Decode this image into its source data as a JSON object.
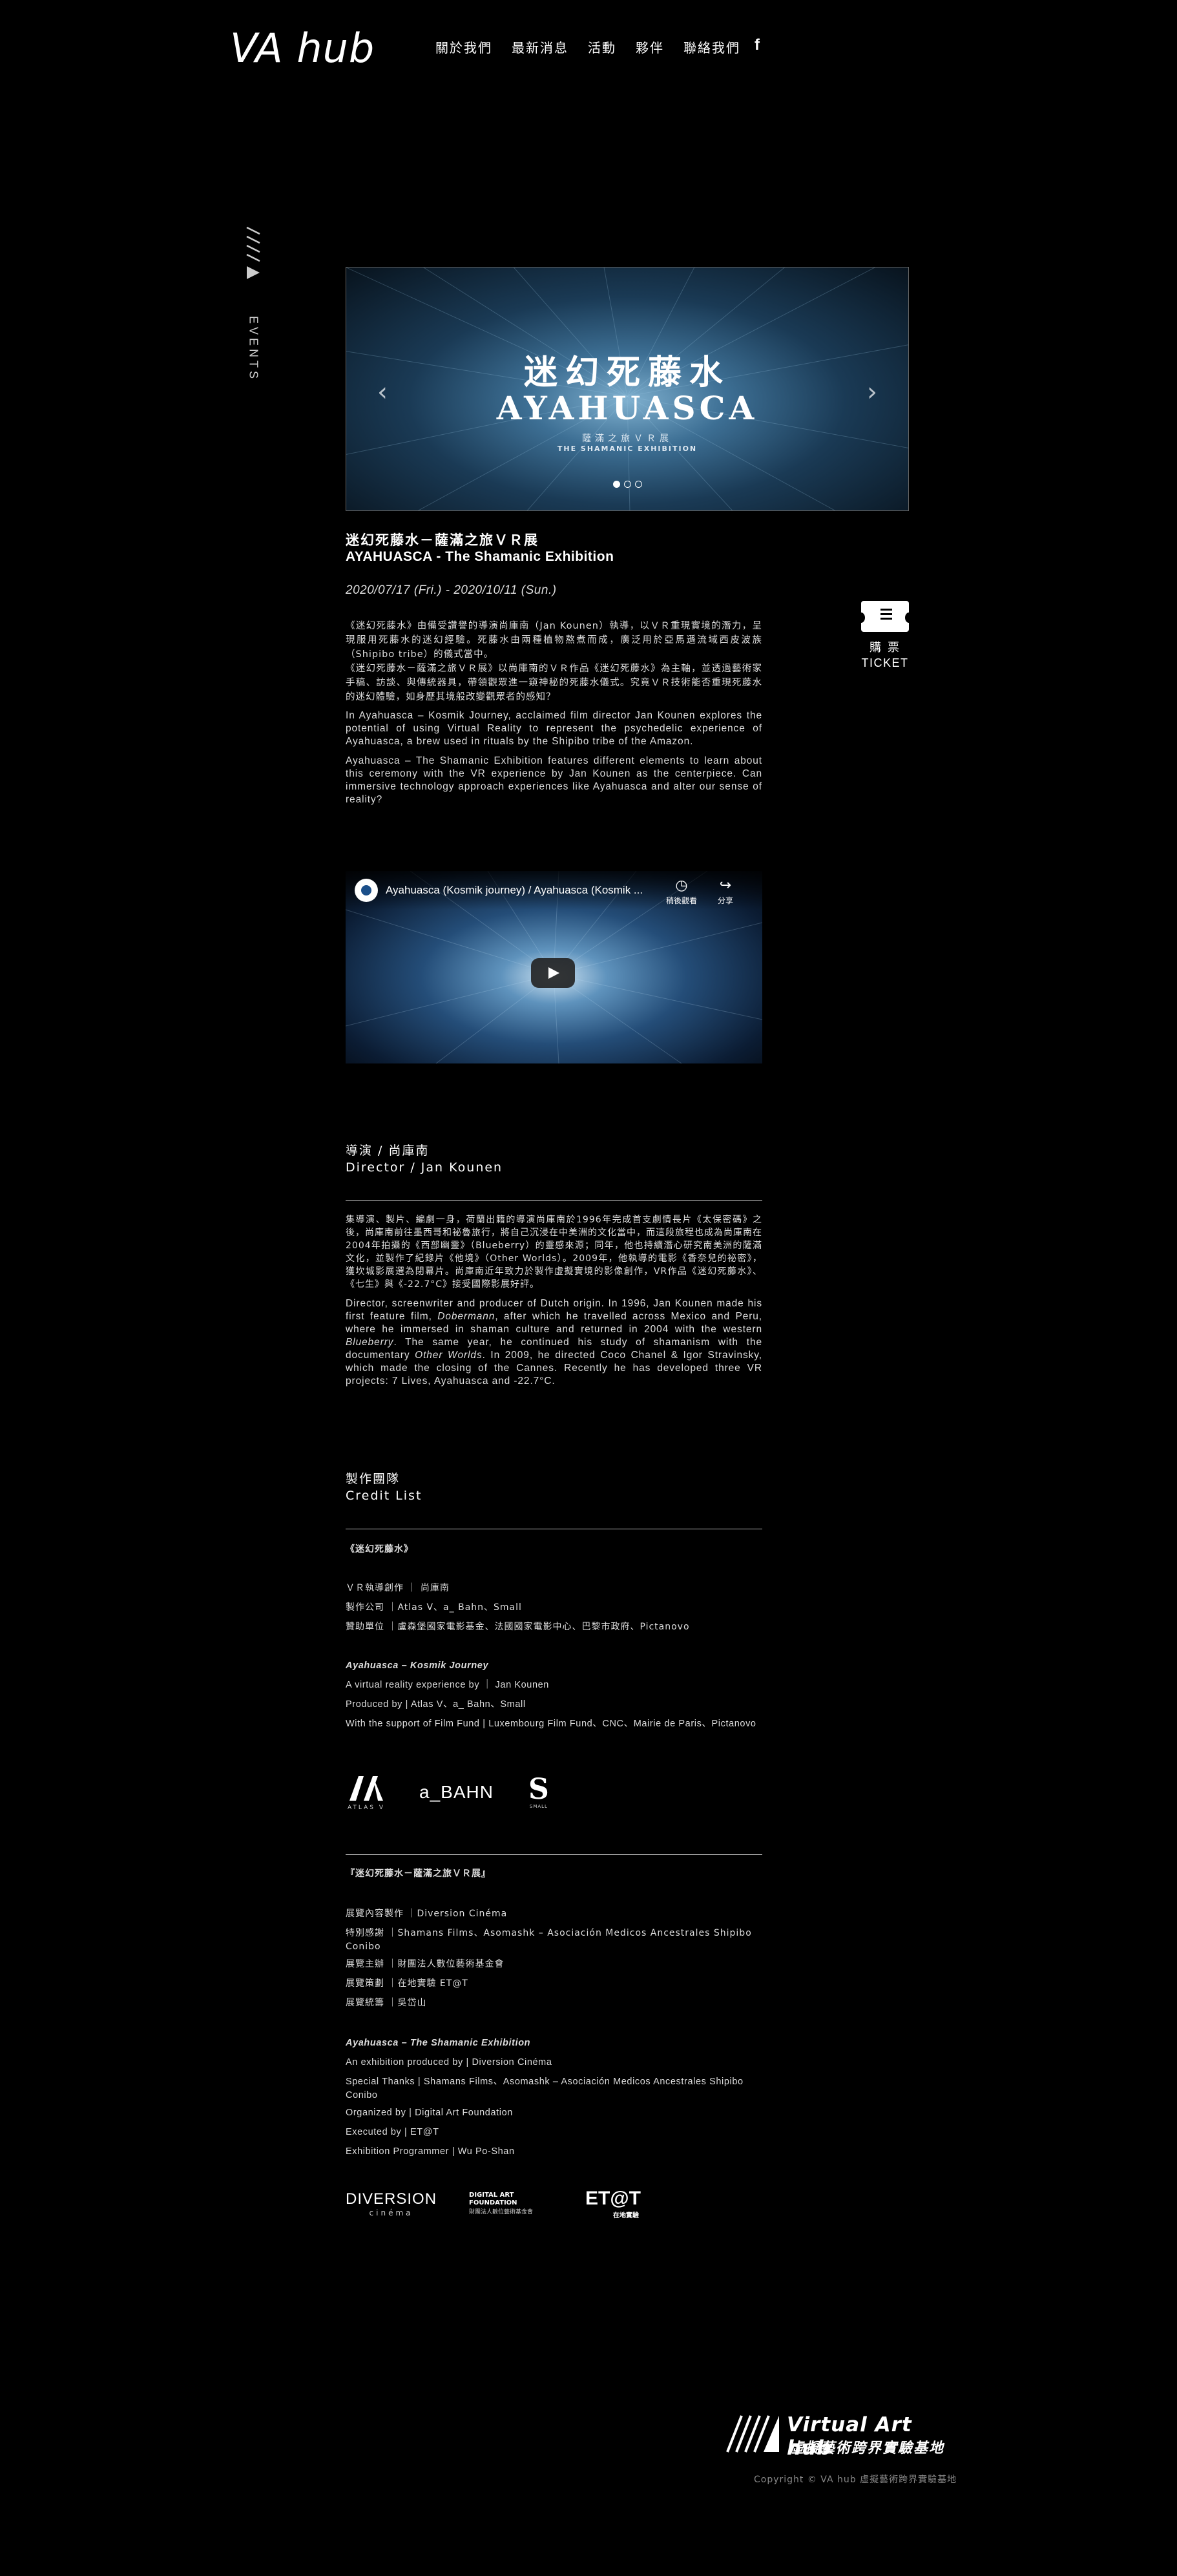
{
  "header": {
    "logo": "VA hub",
    "nav": [
      "關於我們",
      "最新消息",
      "活動",
      "夥伴",
      "聯絡我們"
    ],
    "facebook_icon": "f"
  },
  "side_label": "EVENTS",
  "carousel": {
    "title_cn": "迷幻死藤水",
    "title_en": "AYAHUASCA",
    "subtitle_cn": "薩滿之旅ＶＲ展",
    "subtitle_en": "THE SHAMANIC EXHIBITION",
    "slide_count": 3,
    "active_slide": 1
  },
  "event": {
    "title_cn": "迷幻死藤水－薩滿之旅ＶＲ展",
    "title_en": "AYAHUASCA - The Shamanic Exhibition",
    "date": "2020/07/17 (Fri.) - 2020/10/11 (Sun.)",
    "desc_cn_1": "《迷幻死藤水》由備受讚譽的導演尚庫南（Jan Kounen）執導，以ＶＲ重現實境的潛力，呈現服用死藤水的迷幻經驗。死藤水由兩種植物熬煮而成，廣泛用於亞馬遜流域西皮波族（Shipibo tribe）的儀式當中。",
    "desc_cn_2": "《迷幻死藤水－薩滿之旅ＶＲ展》以尚庫南的ＶＲ作品《迷幻死藤水》為主軸，並透過藝術家手稿、訪談、與傳統器具，帶領觀眾進一窺神秘的死藤水儀式。究竟ＶＲ技術能否重現死藤水的迷幻體驗，如身歷其境般改變觀眾者的感知？",
    "desc_en_1": "In Ayahuasca – Kosmik Journey, acclaimed film director Jan Kounen explores the potential of using Virtual Reality to represent the psychedelic experience of Ayahuasca, a brew used in rituals by the Shipibo tribe of the Amazon.",
    "desc_en_2": "Ayahuasca – The Shamanic Exhibition features different elements to learn about this ceremony with the VR experience by Jan Kounen as the centerpiece. Can immersive technology approach experiences like Ayahuasca and alter our sense of reality?"
  },
  "ticket": {
    "label_cn": "購票",
    "label_en": "TICKET"
  },
  "video": {
    "title": "Ayahuasca (Kosmik journey) / Ayahuasca (Kosmik ...",
    "watch_later": "稍後觀看",
    "share": "分享"
  },
  "director": {
    "heading_cn": "導演 / 尚庫南",
    "heading_en": "Director / Jan Kounen",
    "bio_cn": "集導演、製片、編劇一身，荷蘭出籍的導演尚庫南於1996年完成首支劇情長片《太保密碼》之後，尚庫南前往墨西哥和祕魯旅行，將自己沉浸在中美洲的文化當中，而這段旅程也成為尚庫南在2004年拍攝的《西部幽靈》（Blueberry）的靈感來源；同年，他也持續潛心研究南美洲的薩滿文化，並製作了紀錄片《他境》（Other Worlds）。2009年，他執導的電影《香奈兒的祕密》，獲坎城影展選為閉幕片。尚庫南近年致力於製作虛擬實境的影像創作，VR作品《迷幻死藤水》、《七生》與《-22.7°C》接受國際影展好評。",
    "bio_en_1": "Director, screenwriter and producer of Dutch origin. In 1996, Jan Kounen made his first feature film, ",
    "bio_en_film1": "Dobermann",
    "bio_en_2": ", after which he travelled across Mexico and Peru, where he immersed in shaman culture and returned in 2004 with the western ",
    "bio_en_film2": "Blueberry",
    "bio_en_3": ". The same year, he continued his study of shamanism with the documentary ",
    "bio_en_film3": "Other Worlds",
    "bio_en_4": ". In 2009, he directed Coco Chanel & Igor Stravinsky, which made the closing of the Cannes. Recently he has developed three VR projects: 7 Lives, Ayahuasca and -22.7°C."
  },
  "credits": {
    "heading_cn": "製作團隊",
    "heading_en": "Credit List",
    "vr_title_cn": "《迷幻死藤水》",
    "vr_lines_cn": [
      "ＶＲ執導創作 ｜ 尚庫南",
      "製作公司 ｜Atlas V、a_ Bahn、Small",
      "贊助單位 ｜盧森堡國家電影基金、法國國家電影中心、巴黎市政府、Pictanovo"
    ],
    "vr_title_en": "Ayahuasca – Kosmik Journey",
    "vr_lines_en": [
      "A virtual reality experience by ｜ Jan Kounen",
      "Produced by | Atlas V、a_ Bahn、Small",
      "With the support of Film Fund | Luxembourg Film Fund、CNC、Mairie de Paris、Pictanovo"
    ],
    "vr_logos": [
      "ATLAS V",
      "a_BAHN",
      "SMALL"
    ],
    "exh_title_cn": "『迷幻死藤水－薩滿之旅ＶＲ展』",
    "exh_lines_cn": [
      "展覽內容製作 ｜Diversion Cinéma",
      "特別感謝 ｜Shamans Films、Asomashk – Asociación Medicos Ancestrales Shipibo Conibo",
      "展覽主辦 ｜財團法人數位藝術基金會",
      "展覽策劃 ｜在地實驗 ET@T",
      "展覽統籌 ｜吳岱山"
    ],
    "exh_title_en": "Ayahuasca – The Shamanic Exhibition",
    "exh_lines_en": [
      "An exhibition produced by | Diversion Cinéma",
      "Special Thanks | Shamans Films、Asomashk – Asociación Medicos Ancestrales Shipibo Conibo",
      "Organized by | Digital Art Foundation",
      "Executed by | ET@T",
      "Exhibition Programmer | Wu Po-Shan"
    ],
    "exh_logos": [
      "DIVERSION",
      "cinéma",
      "DIGITAL ART FOUNDATION",
      "財團法人數位藝術基金會",
      "ET@T",
      "在地實驗"
    ]
  },
  "footer": {
    "logo_en": "Virtual Art hub",
    "logo_cn": "虛擬藝術跨界實驗基地",
    "copyright": "Copyright © VA hub 虛擬藝術跨界實驗基地"
  },
  "colors": {
    "background": "#000000",
    "text": "#ffffff",
    "muted": "#dddddd",
    "accent_blue": "#3d6f94"
  }
}
